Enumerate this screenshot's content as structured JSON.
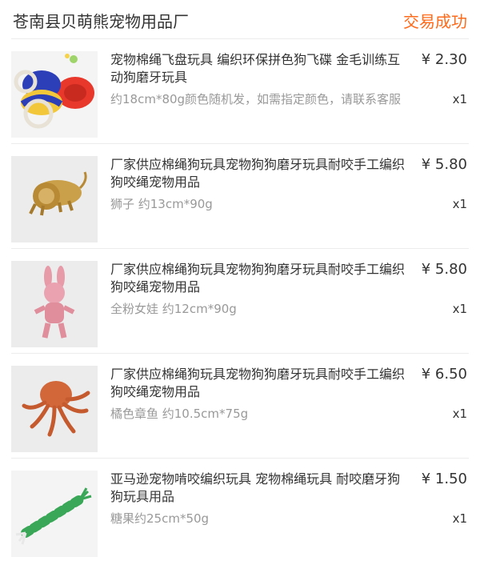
{
  "header": {
    "shop_name": "苍南县贝萌熊宠物用品厂",
    "status": "交易成功"
  },
  "items": [
    {
      "title": "宠物棉绳飞盘玩具 编织环保拼色狗飞碟 金毛训练互动狗磨牙玩具",
      "spec": "约18cm*80g颜色随机发，如需指定颜色，请联系客服",
      "price": "¥ 2.30",
      "qty": "x1",
      "image": "rope-frisbee-toy"
    },
    {
      "title": "厂家供应棉绳狗玩具宠物狗狗磨牙玩具耐咬手工编织狗咬绳宠物用品",
      "spec": "狮子 约13cm*90g",
      "price": "¥ 5.80",
      "qty": "x1",
      "image": "rope-lion-toy"
    },
    {
      "title": "厂家供应棉绳狗玩具宠物狗狗磨牙玩具耐咬手工编织狗咬绳宠物用品",
      "spec": "全粉女娃 约12cm*90g",
      "price": "¥ 5.80",
      "qty": "x1",
      "image": "rope-pink-doll-toy"
    },
    {
      "title": "厂家供应棉绳狗玩具宠物狗狗磨牙玩具耐咬手工编织狗咬绳宠物用品",
      "spec": "橘色章鱼 约10.5cm*75g",
      "price": "¥ 6.50",
      "qty": "x1",
      "image": "rope-octopus-toy"
    },
    {
      "title": "亚马逊宠物啃咬编织玩具 宠物棉绳玩具 耐咬磨牙狗狗玩具用品",
      "spec": "糖果约25cm*50g",
      "price": "¥ 1.50",
      "qty": "x1",
      "image": "rope-candy-toy"
    }
  ]
}
